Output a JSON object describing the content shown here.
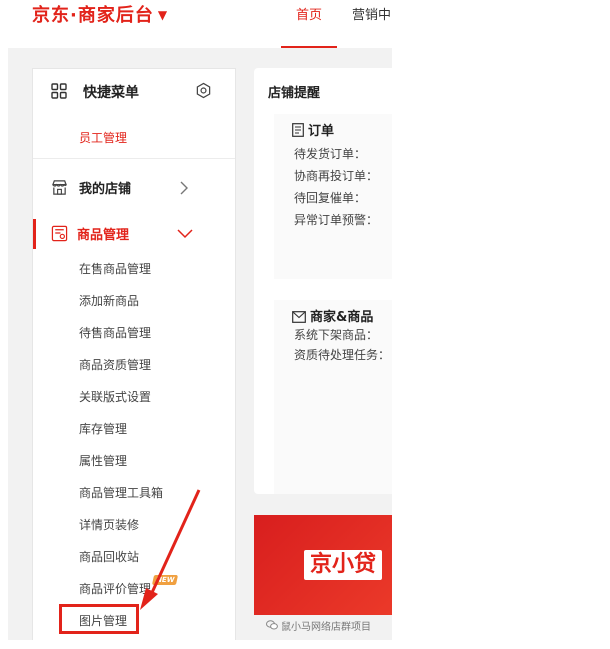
{
  "header": {
    "logo_text": "京东·商家后台",
    "logo_caret": "▼",
    "nav": [
      "首页",
      "营销中"
    ]
  },
  "sidebar": {
    "quick_menu_title": "快捷菜单",
    "quick_items": [
      "员工管理"
    ],
    "my_shop_label": "我的店铺",
    "goods_label": "商品管理",
    "goods_items": [
      "在售商品管理",
      "添加新商品",
      "待售商品管理",
      "商品资质管理",
      "关联版式设置",
      "库存管理",
      "属性管理",
      "商品管理工具箱",
      "详情页装修",
      "商品回收站",
      "商品评价管理",
      "图片管理"
    ],
    "new_badge": "NEW"
  },
  "reminder": {
    "title": "店铺提醒",
    "orders": {
      "title": "订单",
      "lines": [
        "待发货订单：",
        "协商再投订单：",
        "待回复催单：",
        "异常订单预警："
      ]
    },
    "merchant_goods": {
      "title": "商家&商品",
      "lines": [
        "系统下架商品：",
        "资质待处理任务："
      ]
    }
  },
  "banner": {
    "text": "京小贷"
  },
  "watermark": "鼠小马网络店群项目",
  "colors": {
    "accent": "#e2231a",
    "background": "#f2f2f2"
  }
}
